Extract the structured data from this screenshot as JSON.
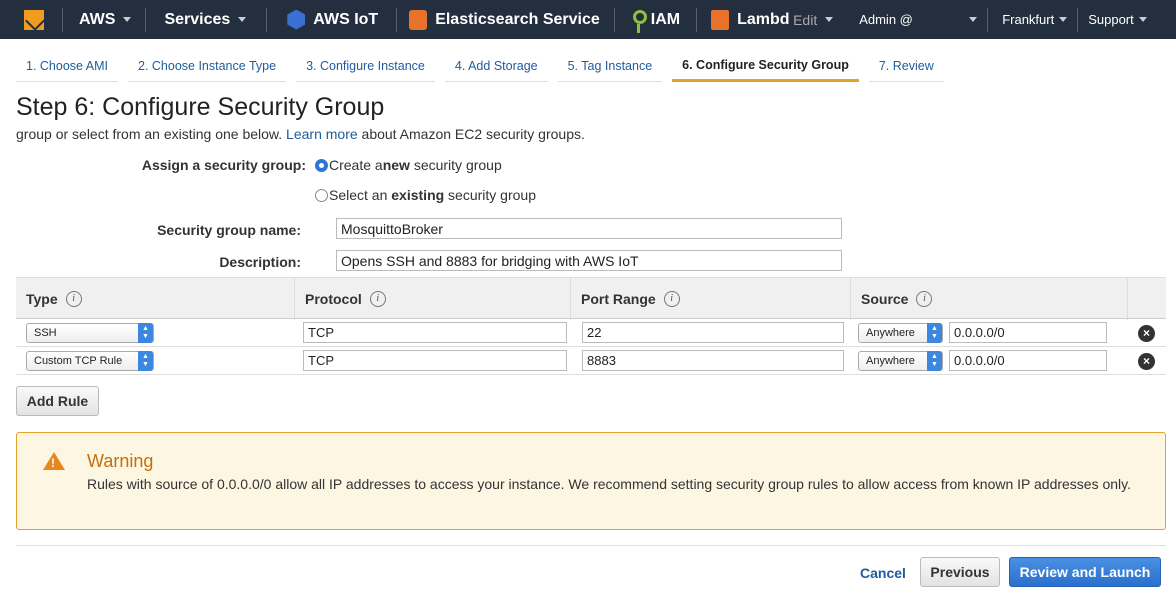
{
  "topnav": {
    "aws": "AWS",
    "services": "Services",
    "iot": "AWS IoT",
    "elasticsearch": "Elasticsearch Service",
    "iam": "IAM",
    "lambda": "Lambd",
    "edit": "Edit",
    "user": "Admin @",
    "region": "Frankfurt",
    "support": "Support"
  },
  "tabs": [
    {
      "label": "1. Choose AMI"
    },
    {
      "label": "2. Choose Instance Type"
    },
    {
      "label": "3. Configure Instance"
    },
    {
      "label": "4. Add Storage"
    },
    {
      "label": "5. Tag Instance"
    },
    {
      "label": "6. Configure Security Group",
      "active": true
    },
    {
      "label": "7. Review"
    }
  ],
  "page": {
    "title": "Step 6: Configure Security Group",
    "subtitle_pre": "group or select from an existing one below.",
    "learn_more": "Learn more",
    "subtitle_post": "about Amazon EC2 security groups."
  },
  "form": {
    "assign_label": "Assign a security group:",
    "option_create_pre": "Create a ",
    "option_create_bold": "new",
    "option_create_post": " security group",
    "option_select_pre": "Select an ",
    "option_select_bold": "existing",
    "option_select_post": " security group",
    "name_label": "Security group name:",
    "name_value": "MosquittoBroker",
    "desc_label": "Description:",
    "desc_value": "Opens SSH and 8883 for bridging with AWS IoT"
  },
  "table": {
    "headers": {
      "type": "Type",
      "protocol": "Protocol",
      "port_range": "Port Range",
      "source": "Source"
    },
    "info_glyph": "i",
    "rows": [
      {
        "type": "SSH",
        "protocol": "TCP",
        "port": "22",
        "source": "Anywhere",
        "cidr": "0.0.0.0/0"
      },
      {
        "type": "Custom TCP Rule",
        "protocol": "TCP",
        "port": "8883",
        "source": "Anywhere",
        "cidr": "0.0.0.0/0"
      }
    ],
    "remove_glyph": "×"
  },
  "buttons": {
    "add_rule": "Add Rule",
    "cancel": "Cancel",
    "previous": "Previous",
    "review_launch": "Review and Launch"
  },
  "warning": {
    "title": "Warning",
    "glyph": "!",
    "text": "Rules with source of 0.0.0.0/0 allow all IP addresses to access your instance. We recommend setting security group rules to allow access from known IP addresses only."
  },
  "colors": {
    "nav_bg": "#232f3e",
    "accent": "#e3a229",
    "link": "#1f5b9e",
    "primary_button": "#2a6fcc",
    "warning_border": "#e3a229",
    "warning_bg": "#fdf6e3"
  }
}
